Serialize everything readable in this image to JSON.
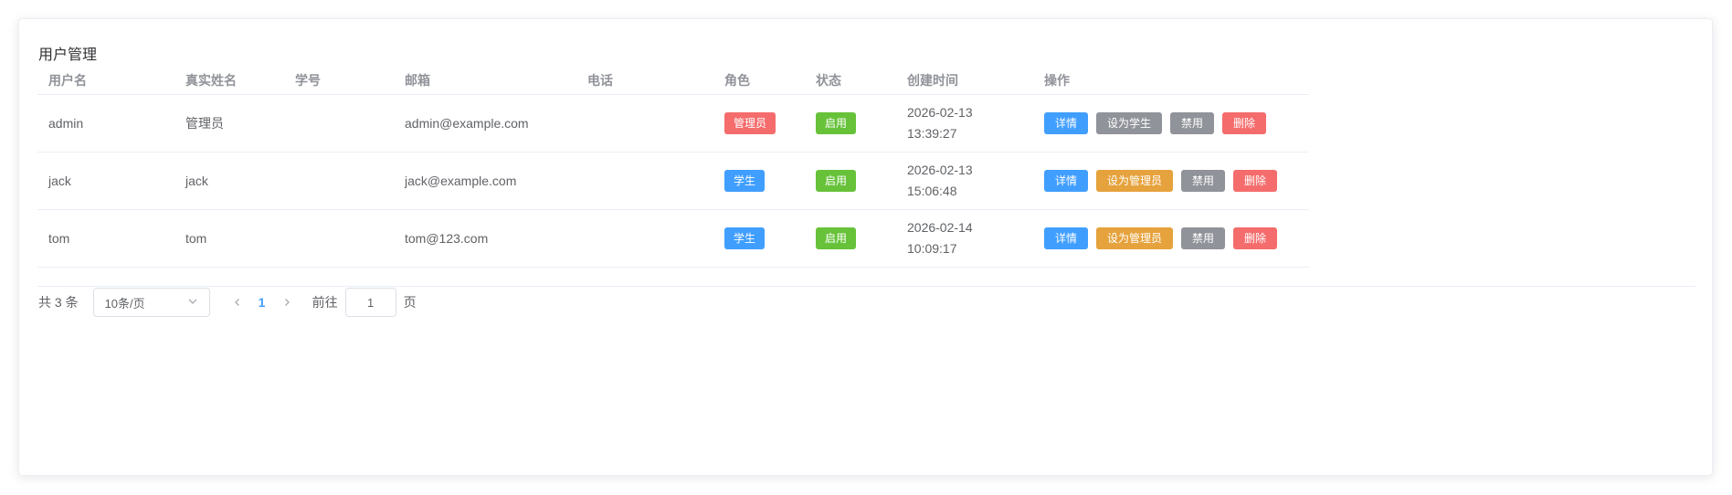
{
  "page_title": "用户管理",
  "colors": {
    "primary": "#409eff",
    "success": "#67c23a",
    "warning": "#e6a23c",
    "danger": "#f56c6c",
    "info": "#909399"
  },
  "table": {
    "columns": [
      "用户名",
      "真实姓名",
      "学号",
      "邮箱",
      "电话",
      "角色",
      "状态",
      "创建时间",
      "操作"
    ],
    "rows": [
      {
        "username": "admin",
        "real_name": "管理员",
        "student_id": "",
        "email": "admin@example.com",
        "phone": "",
        "role": "管理员",
        "role_color": "#f56c6c",
        "status": "启用",
        "created_date": "2026-02-13",
        "created_time": "13:39:27",
        "actions": {
          "detail": "详情",
          "set_role": "设为学生",
          "set_role_color": "#909399",
          "disable": "禁用",
          "delete": "删除"
        }
      },
      {
        "username": "jack",
        "real_name": "jack",
        "student_id": "",
        "email": "jack@example.com",
        "phone": "",
        "role": "学生",
        "role_color": "#409eff",
        "status": "启用",
        "created_date": "2026-02-13",
        "created_time": "15:06:48",
        "actions": {
          "detail": "详情",
          "set_role": "设为管理员",
          "set_role_color": "#e6a23c",
          "disable": "禁用",
          "delete": "删除"
        }
      },
      {
        "username": "tom",
        "real_name": "tom",
        "student_id": "",
        "email": "tom@123.com",
        "phone": "",
        "role": "学生",
        "role_color": "#409eff",
        "status": "启用",
        "created_date": "2026-02-14",
        "created_time": "10:09:17",
        "actions": {
          "detail": "详情",
          "set_role": "设为管理员",
          "set_role_color": "#e6a23c",
          "disable": "禁用",
          "delete": "删除"
        }
      }
    ]
  },
  "pagination": {
    "total_text": "共 3 条",
    "page_size": "10条/页",
    "prev_icon": "chevron-left-icon",
    "next_icon": "chevron-right-icon",
    "current_page": "1",
    "goto_label": "前往",
    "goto_value": "1",
    "page_suffix": "页"
  }
}
